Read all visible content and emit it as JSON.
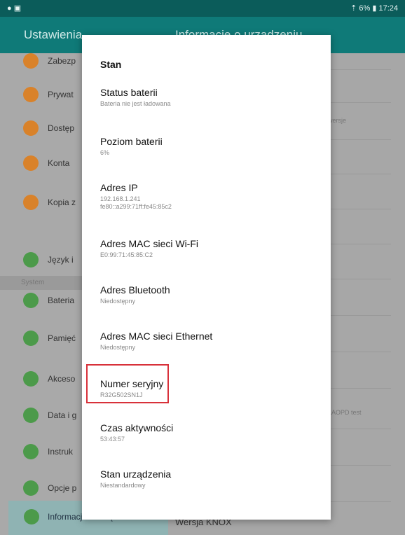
{
  "status_bar": {
    "left_icons": "● ▣",
    "right": "⇡ 6% ▮ 17:24"
  },
  "app_bar": {
    "title": "Ustawienia",
    "subtitle": "Informacje o urządzeniu"
  },
  "menu": {
    "items": [
      {
        "label": "Zabezp",
        "color": "orange"
      },
      {
        "label": "Prywat",
        "color": "orange"
      },
      {
        "label": "Dostęp",
        "color": "orange"
      },
      {
        "label": "Konta",
        "color": "orange"
      },
      {
        "label": "Kopia z",
        "color": "orange"
      },
      {
        "label": "Język i",
        "color": "green"
      },
      {
        "label": "Bateria",
        "color": "green"
      },
      {
        "label": "Pamięć",
        "color": "green"
      },
      {
        "label": "Akceso",
        "color": "green"
      },
      {
        "label": "Data i g",
        "color": "green"
      },
      {
        "label": "Instruk",
        "color": "green"
      },
      {
        "label": "Opcje p",
        "color": "green"
      },
      {
        "label": "Informacje o urządz.",
        "color": "green"
      }
    ],
    "section_system": "System"
  },
  "right_pane": {
    "snippet_1": "wersje",
    "snippet_2": "LAOPD test",
    "bottom_title": "Wersja KNOX"
  },
  "dialog": {
    "title": "Stan",
    "items": [
      {
        "title": "Status baterii",
        "subtitle": "Bateria nie jest ładowana"
      },
      {
        "title": "Poziom baterii",
        "subtitle": "6%"
      },
      {
        "title": "Adres IP",
        "subtitle": "192.168.1.241",
        "subtitle2": "fe80::a299:71ff:fe45:85c2"
      },
      {
        "title": "Adres MAC sieci Wi-Fi",
        "subtitle": "E0:99:71:45:85:C2"
      },
      {
        "title": "Adres Bluetooth",
        "subtitle": "Niedostępny"
      },
      {
        "title": "Adres MAC sieci Ethernet",
        "subtitle": "Niedostępny"
      },
      {
        "title": "Numer seryjny",
        "subtitle": "R32G502SN1J"
      },
      {
        "title": "Czas aktywności",
        "subtitle": "53:43:57"
      },
      {
        "title": "Stan urządzenia",
        "subtitle": "Niestandardowy"
      }
    ]
  }
}
